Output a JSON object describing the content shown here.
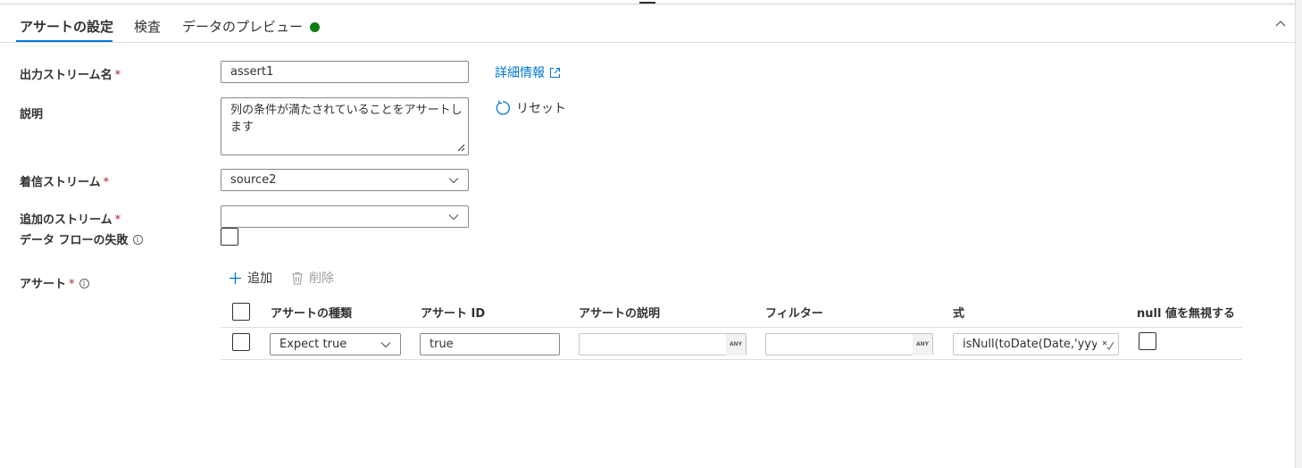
{
  "tabs": [
    {
      "label": "アサートの設定",
      "active": true
    },
    {
      "label": "検査",
      "active": false
    },
    {
      "label": "データのプレビュー",
      "active": false
    }
  ],
  "status_color": "#107c10",
  "form": {
    "output_stream": {
      "label": "出力ストリーム名",
      "required": "*",
      "value": "assert1"
    },
    "learn_more": "詳細情報",
    "description": {
      "label": "説明",
      "value": "列の条件が満たされていることをアサートします"
    },
    "reset": "リセット",
    "incoming_stream": {
      "label": "着信ストリーム",
      "required": "*",
      "value": "source2"
    },
    "additional_streams": {
      "label": "追加のストリーム",
      "required": "*",
      "value": ""
    },
    "fail_data_flow": {
      "label": "データ フローの失敗",
      "checked": false
    },
    "asserts": {
      "label": "アサート",
      "required": "*"
    }
  },
  "toolbar": {
    "add": "追加",
    "delete": "削除"
  },
  "table": {
    "headers": [
      "アサートの種類",
      "アサート ID",
      "アサートの説明",
      "フィルター",
      "式",
      "null 値を無視する"
    ],
    "rows": [
      {
        "type": "Expect true",
        "id": "true",
        "description": "",
        "filter": "",
        "expression": "isNull(toDate(Date,'yyyy...",
        "ignore_null": false
      }
    ],
    "any_badge": "ANY"
  },
  "accent_color": "#0078d4"
}
